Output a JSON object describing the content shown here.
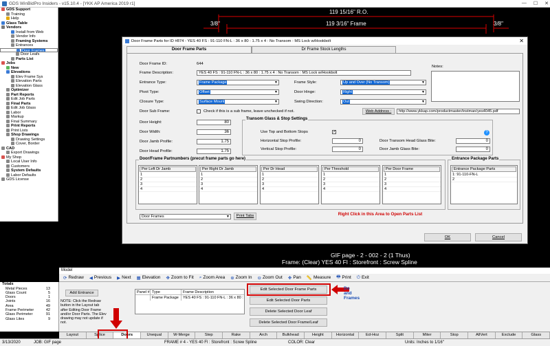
{
  "window": {
    "title": "GDS WinBidPro Insiders - v15.10.4 - [YKK AP America 2019 r1]"
  },
  "tree": [
    {
      "label": "GDS Support",
      "bold": true,
      "indent": 0,
      "color": "#d9534f"
    },
    {
      "label": "Training",
      "bold": false,
      "indent": 1,
      "color": "#888"
    },
    {
      "label": "Help",
      "bold": false,
      "indent": 1,
      "color": "#e6a700"
    },
    {
      "label": "Glass Table",
      "bold": true,
      "indent": 0,
      "color": "#3a7bd5"
    },
    {
      "label": "Vendors",
      "bold": true,
      "indent": 0,
      "color": "#777"
    },
    {
      "label": "Install from Web",
      "bold": false,
      "indent": 2,
      "color": "#3a7bd5"
    },
    {
      "label": "Vendor Info",
      "bold": false,
      "indent": 2,
      "color": "#888"
    },
    {
      "label": "Framing Systems",
      "bold": true,
      "indent": 2,
      "color": "#888"
    },
    {
      "label": "Entrances",
      "bold": false,
      "indent": 2,
      "color": "#888"
    },
    {
      "label": "Door Frames",
      "bold": false,
      "indent": 3,
      "color": "#3a7bd5",
      "selected": true
    },
    {
      "label": "Door Leafs",
      "bold": false,
      "indent": 3,
      "color": "#888"
    },
    {
      "label": "Parts List",
      "bold": true,
      "indent": 2,
      "color": "#888"
    },
    {
      "label": "Jobs",
      "bold": true,
      "indent": 0,
      "color": "#d9534f"
    },
    {
      "label": "New",
      "bold": true,
      "indent": 1,
      "color": "#5cb85c"
    },
    {
      "label": "Elevations",
      "bold": true,
      "indent": 1,
      "color": "#3a7bd5"
    },
    {
      "label": "Elev Frame Sys",
      "bold": false,
      "indent": 2,
      "color": "#888"
    },
    {
      "label": "Elevation Parts",
      "bold": false,
      "indent": 2,
      "color": "#888"
    },
    {
      "label": "Elevation Glass",
      "bold": false,
      "indent": 2,
      "color": "#888"
    },
    {
      "label": "Optimizer",
      "bold": true,
      "indent": 1,
      "color": "#888"
    },
    {
      "label": "Part Reports",
      "bold": true,
      "indent": 1,
      "color": "#888"
    },
    {
      "label": "Edit Job Parts",
      "bold": false,
      "indent": 1,
      "color": "#888"
    },
    {
      "label": "Final Parts",
      "bold": true,
      "indent": 1,
      "color": "#888"
    },
    {
      "label": "Edit Job Glass",
      "bold": false,
      "indent": 1,
      "color": "#888"
    },
    {
      "label": "Labor",
      "bold": false,
      "indent": 1,
      "color": "#888"
    },
    {
      "label": "Markup",
      "bold": false,
      "indent": 1,
      "color": "#888"
    },
    {
      "label": "Final Summary",
      "bold": false,
      "indent": 1,
      "color": "#888"
    },
    {
      "label": "Print Reports",
      "bold": true,
      "indent": 1,
      "color": "#888"
    },
    {
      "label": "Print Lists",
      "bold": false,
      "indent": 1,
      "color": "#888"
    },
    {
      "label": "Shop Drawings",
      "bold": true,
      "indent": 1,
      "color": "#888"
    },
    {
      "label": "Drawing Settings",
      "bold": false,
      "indent": 2,
      "color": "#888"
    },
    {
      "label": "Cover, Border",
      "bold": false,
      "indent": 2,
      "color": "#888"
    },
    {
      "label": "CAD",
      "bold": true,
      "indent": 0,
      "color": "#888"
    },
    {
      "label": "Export Drawings",
      "bold": false,
      "indent": 1,
      "color": "#888"
    },
    {
      "label": "My Shop",
      "bold": false,
      "indent": 0,
      "color": "#d9534f"
    },
    {
      "label": "Local User Info",
      "bold": false,
      "indent": 1,
      "color": "#888"
    },
    {
      "label": "Customers",
      "bold": false,
      "indent": 1,
      "color": "#888"
    },
    {
      "label": "System Defaults",
      "bold": true,
      "indent": 1,
      "color": "#888"
    },
    {
      "label": "Labor Defaults",
      "bold": false,
      "indent": 1,
      "color": "#888"
    },
    {
      "label": "GDS License",
      "bold": false,
      "indent": 0,
      "color": "#888"
    }
  ],
  "drawing": {
    "ro": "119 15/16\" R.O.",
    "frame": "119 3/16\" Frame",
    "left_gap": "3/8\"",
    "right_gap": "3/8\"",
    "gif_line1": "GIF page - 2 - 002 - 2 (1 Thus)",
    "gif_line2": "Frame: (Clear) YES 40 Fl : Storefront : Screw Spline"
  },
  "modal": {
    "title": "Door Frame Parts for ID #874 - YES 40 FS : 91-110 FN-L : 36 x 80 : 1.75 x 4 : No Transom : MS Lock w/Hookbolt",
    "tab1": "Door Frame Parts",
    "tab2": "Dr Frame Stock Lengths",
    "id_label": "Door Frame ID:",
    "id_value": "644",
    "desc_label": "Frame Description:",
    "desc_value": "YES 40 FS : 91-110 FN-L : 36 x 80 : 1.75 x 4 : No Transom : MS Lock w/Hookbolt",
    "notes_label": "Notes:",
    "entrance_type_label": "Entrance Type:",
    "entrance_type_value": "Frame Package",
    "frame_style_label": "Frame Style:",
    "frame_style_value": "Up and Over (No Transom)",
    "pivot_type_label": "Pivot Type:",
    "pivot_type_value": "Offset",
    "door_hinge_label": "Door Hinge:",
    "door_hinge_value": "Right",
    "closure_type_label": "Closure Type:",
    "closure_type_value": "Surface Mount",
    "swing_label": "Swing Direction:",
    "swing_value": "Out",
    "subframe_label": "Door Sub Frame:",
    "subframe_check": "Check if this is a sub frame, leave unchecked if not.",
    "web_btn": "Web Address :",
    "web_value": "http://www.ykkap.com/productmaster/instman/yes4045.pdf",
    "height_label": "Door Height:",
    "height_value": "80",
    "width_label": "Door Width:",
    "width_value": "36",
    "jamb_label": "Door Jamb Profile:",
    "jamb_value": "1.75",
    "head_label": "Door Head Profile:",
    "head_value": "1.75",
    "transom_group": "Transom Glass & Stop Settings",
    "use_stops_label": "Use Top and Bottom Stops",
    "hstop_label": "Horizontal Stop Profile:",
    "hstop_value": "0",
    "vstop_label": "Vertical Stop Profile:",
    "vstop_value": "0",
    "head_glass_label": "Door Transom Head Glass Bite:",
    "head_glass_value": "0",
    "jamb_glass_label": "Door Jamb Glass Bite:",
    "jamb_glass_value": "0",
    "partnumbers_group": "Door/Frame Partnumbers (precut frame parts go here)",
    "pkg_group": "Entrance Package Parts",
    "subtables": [
      "Per Left Dr Jamb",
      "Per Right Dr Jamb",
      "Per Dr Head",
      "Per Threshold",
      "Per Door Frame"
    ],
    "pkg_header": "Entrance Package Parts",
    "pkg_row1": "1: 91-110-FN-L",
    "row_nums": [
      "1",
      "2",
      "3",
      "4"
    ],
    "footer_select": "Door Frames",
    "print_tabs": "Print Tabs",
    "right_click": "Right Click in this Area to Open Parts List",
    "ok": "OK",
    "cancel": "Cancel"
  },
  "model_bar": "Model",
  "toolbar": [
    {
      "icon": "redraw-icon",
      "label": "Redraw"
    },
    {
      "icon": "previous-icon",
      "label": "Previous"
    },
    {
      "icon": "next-icon",
      "label": "Next"
    },
    {
      "icon": "elevation-icon",
      "label": "Elevation"
    },
    {
      "icon": "zoom-fit-icon",
      "label": "Zoom to Fit"
    },
    {
      "icon": "zoom-area-icon",
      "label": "Zoom Area"
    },
    {
      "icon": "zoom-in-icon",
      "label": "Zoom In"
    },
    {
      "icon": "zoom-out-icon",
      "label": "Zoom Out"
    },
    {
      "icon": "pan-icon",
      "label": "Pan"
    },
    {
      "icon": "measure-icon",
      "label": "Measure"
    },
    {
      "icon": "print-icon",
      "label": "Print"
    },
    {
      "icon": "exit-icon",
      "label": "Exit"
    }
  ],
  "totals": {
    "title": "Totals",
    "rows": [
      {
        "k": "Metal Pieces",
        "v": "13"
      },
      {
        "k": "Glass Count",
        "v": "5"
      },
      {
        "k": "Doors",
        "v": "1"
      },
      {
        "k": "Joints",
        "v": "16"
      },
      {
        "k": "Area",
        "v": "49"
      },
      {
        "k": "Frame Perimeter",
        "v": "42"
      },
      {
        "k": "Glass Perimeter",
        "v": "91"
      },
      {
        "k": "Glass Lites",
        "v": "9"
      }
    ]
  },
  "layout": {
    "add_entrance": "Add Entrance",
    "note": "NOTE: Click the Redraw button in the Layout tab after Editing Door Frame and/or Door Parts. The Elev drawing may not update if not.",
    "col1": "Panel #",
    "col2": "Type",
    "col3": "Frame Description",
    "row_type": "Frame Package",
    "row_desc": "YES 40 FS : 91-110 FN-L : 36 x 80 : 1.7",
    "btn_edit_frame": "Edit Selected Door Frame Parts",
    "btn_edit_door": "Edit Selected Door Parts",
    "btn_del_leaf": "Delete Selected Door Leaf",
    "btn_del_frame": "Delete Selected Door Frame/Leaf",
    "side_text1": "Do",
    "side_text2": "and",
    "side_text3": "Frames"
  },
  "bottom_tabs": [
    "Layout",
    "Splice",
    "Doors",
    "Unequal",
    "W-Merge",
    "Step",
    "Rake",
    "Arch",
    "Bulkhead",
    "Height",
    "Horizontal",
    "Ed-Hoz",
    "Split",
    "Miter",
    "Stop",
    "AllVert",
    "Exclude",
    "Glass"
  ],
  "status": {
    "date": "3/13/2020",
    "job": "JOB: GIF page",
    "frame": "FRAME # 4 - YES 40 Fl : Storefront : Screw Spline",
    "color": "COLOR: Clear",
    "units": "Units: Inches to 1/16\""
  },
  "colors": {
    "accent": "#d00000",
    "select": "#0a64d6"
  }
}
